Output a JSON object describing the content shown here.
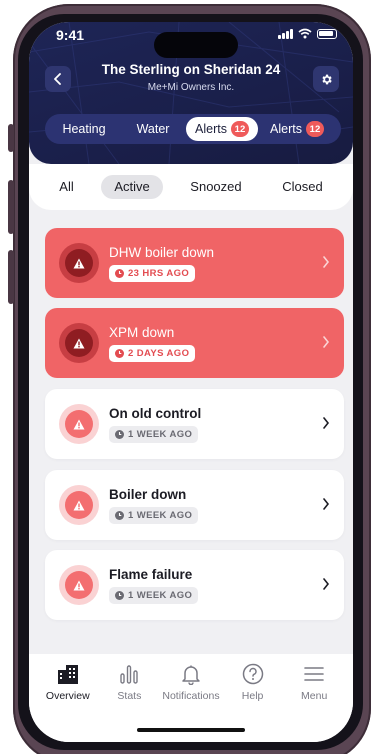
{
  "status_bar": {
    "time": "9:41"
  },
  "header": {
    "title": "The Sterling on Sheridan 24",
    "subtitle": "Me+Mi Owners Inc.",
    "back_icon": "chevron-left-icon",
    "settings_icon": "gear-icon"
  },
  "tabs": [
    {
      "label": "Heating",
      "active": false
    },
    {
      "label": "Water",
      "active": false
    },
    {
      "label": "Alerts",
      "active": true,
      "badge": "12"
    },
    {
      "label": "Alerts",
      "active": false,
      "badge": "12"
    }
  ],
  "filters": [
    {
      "label": "All",
      "active": false
    },
    {
      "label": "Active",
      "active": true
    },
    {
      "label": "Snoozed",
      "active": false
    },
    {
      "label": "Closed",
      "active": false
    }
  ],
  "alerts": [
    {
      "title": "DHW boiler down",
      "time": "23 HRS AGO",
      "severity": "critical",
      "icon": "warning-icon"
    },
    {
      "title": "XPM down",
      "time": "2 DAYS AGO",
      "severity": "critical",
      "icon": "warning-icon"
    },
    {
      "title": "On old control",
      "time": "1 WEEK AGO",
      "severity": "normal",
      "icon": "warning-icon"
    },
    {
      "title": "Boiler down",
      "time": "1 WEEK AGO",
      "severity": "normal",
      "icon": "warning-icon"
    },
    {
      "title": "Flame failure",
      "time": "1 WEEK AGO",
      "severity": "normal",
      "icon": "warning-icon"
    }
  ],
  "bottom_nav": [
    {
      "label": "Overview",
      "icon": "building-icon",
      "active": true
    },
    {
      "label": "Stats",
      "icon": "stats-icon",
      "active": false
    },
    {
      "label": "Notifications",
      "icon": "bell-icon",
      "active": false
    },
    {
      "label": "Help",
      "icon": "help-icon",
      "active": false
    },
    {
      "label": "Menu",
      "icon": "menu-icon",
      "active": false
    }
  ],
  "colors": {
    "header_navy": "#1e2556",
    "alert_red": "#f06466",
    "badge_red": "#ef5a5a",
    "background": "#f0f0f3"
  }
}
